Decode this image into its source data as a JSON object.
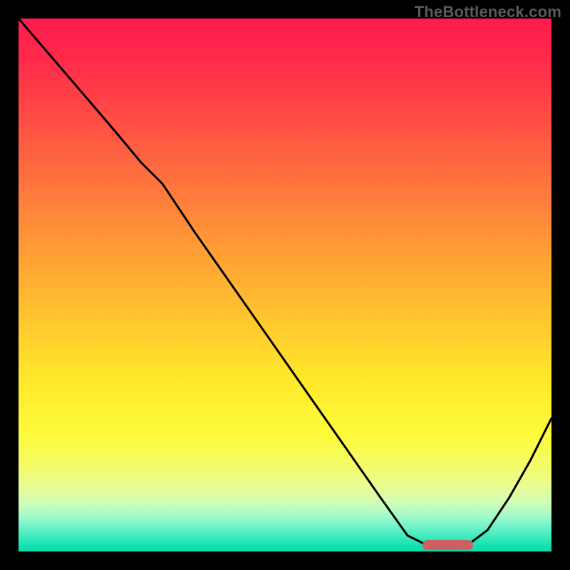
{
  "watermark": "TheBottleneck.com",
  "marker": {
    "color": "#cd6063",
    "x_frac": 0.805,
    "y_frac": 0.988,
    "width_frac": 0.095,
    "height_frac": 0.018
  },
  "chart_data": {
    "type": "line",
    "title": "",
    "xlabel": "",
    "ylabel": "",
    "xlim": [
      0,
      100
    ],
    "ylim": [
      0,
      100
    ],
    "grid": false,
    "legend": false,
    "background": "vertical-gradient red→orange→yellow→green",
    "series": [
      {
        "name": "bottleneck-curve",
        "color": "#000000",
        "x": [
          0,
          6,
          12,
          18,
          23,
          27,
          33,
          40,
          47,
          54,
          61,
          68,
          73,
          77,
          80,
          84,
          88,
          92,
          96,
          100
        ],
        "y": [
          100,
          93,
          86,
          79,
          73,
          69,
          60,
          50,
          40,
          30,
          20,
          10,
          3,
          1,
          1,
          1,
          4,
          10,
          17,
          25
        ]
      }
    ],
    "annotations": [
      {
        "type": "marker-bar",
        "color": "#cd6063",
        "x_range": [
          76,
          85
        ],
        "y": 1
      }
    ]
  }
}
